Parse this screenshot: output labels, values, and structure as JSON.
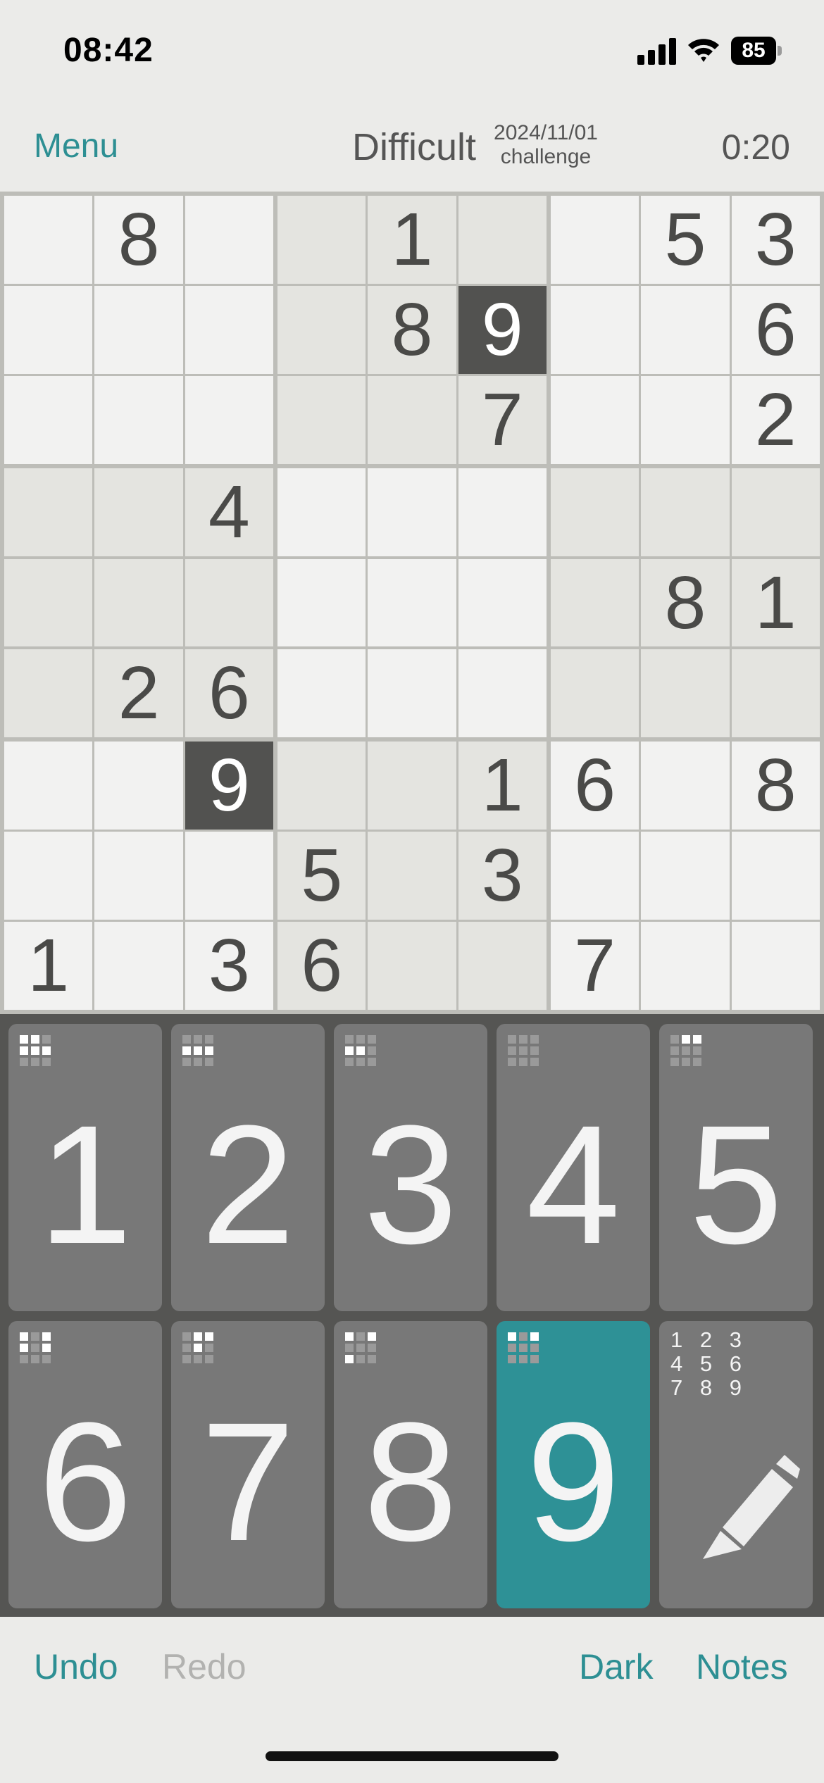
{
  "status_bar": {
    "time": "08:42",
    "battery": "85",
    "icons": [
      "signal-icon",
      "wifi-icon",
      "battery-icon"
    ]
  },
  "header": {
    "menu_label": "Menu",
    "difficulty": "Difficult",
    "date": "2024/11/01",
    "challenge": "challenge",
    "timer": "0:20"
  },
  "board": {
    "grid": [
      [
        "",
        "8",
        "",
        "",
        "1",
        "",
        "",
        "5",
        "3"
      ],
      [
        "",
        "",
        "",
        "",
        "8",
        "9",
        "",
        "",
        "6"
      ],
      [
        "",
        "",
        "",
        "",
        "",
        "7",
        "",
        "",
        "2"
      ],
      [
        "",
        "",
        "4",
        "",
        "",
        "",
        "",
        "",
        ""
      ],
      [
        "",
        "",
        "",
        "",
        "",
        "",
        "",
        "8",
        "1"
      ],
      [
        "",
        "2",
        "6",
        "",
        "",
        "",
        "",
        "",
        ""
      ],
      [
        "",
        "",
        "9",
        "",
        "",
        "1",
        "6",
        "",
        "8"
      ],
      [
        "",
        "",
        "",
        "5",
        "",
        "3",
        "",
        "",
        ""
      ],
      [
        "1",
        "",
        "3",
        "6",
        "",
        "",
        "7",
        "",
        ""
      ]
    ],
    "highlighted_value": "9",
    "colors": {
      "light": "#f2f2f1",
      "shaded": "#e4e4e0",
      "selected": "#525250",
      "digit": "#4a4a48"
    }
  },
  "keypad": {
    "keys": [
      {
        "label": "1",
        "active": false,
        "mini": [
          1,
          1,
          0,
          1,
          1,
          1,
          0,
          0,
          0
        ]
      },
      {
        "label": "2",
        "active": false,
        "mini": [
          0,
          0,
          0,
          1,
          1,
          1,
          0,
          0,
          0
        ]
      },
      {
        "label": "3",
        "active": false,
        "mini": [
          0,
          0,
          0,
          1,
          1,
          0,
          0,
          0,
          0
        ]
      },
      {
        "label": "4",
        "active": false,
        "mini": [
          0,
          0,
          0,
          0,
          0,
          0,
          0,
          0,
          0
        ]
      },
      {
        "label": "5",
        "active": false,
        "mini": [
          0,
          1,
          1,
          0,
          0,
          0,
          0,
          0,
          0
        ]
      },
      {
        "label": "6",
        "active": false,
        "mini": [
          1,
          0,
          1,
          1,
          0,
          1,
          0,
          0,
          0
        ]
      },
      {
        "label": "7",
        "active": false,
        "mini": [
          0,
          1,
          1,
          0,
          1,
          0,
          0,
          0,
          0
        ]
      },
      {
        "label": "8",
        "active": false,
        "mini": [
          1,
          0,
          1,
          0,
          0,
          0,
          1,
          0,
          0
        ]
      },
      {
        "label": "9",
        "active": true,
        "mini": [
          1,
          0,
          1,
          0,
          0,
          0,
          0,
          0,
          0
        ]
      }
    ],
    "notes_key": {
      "grid_text": "1 2 3\n4 5 6\n7 8 9",
      "icon": "pencil-icon"
    },
    "colors": {
      "key": "#787878",
      "active": "#2e9196",
      "background": "#555553"
    }
  },
  "toolbar": {
    "undo": "Undo",
    "redo": "Redo",
    "dark": "Dark",
    "notes": "Notes"
  },
  "accent_color": "#2d8f93"
}
